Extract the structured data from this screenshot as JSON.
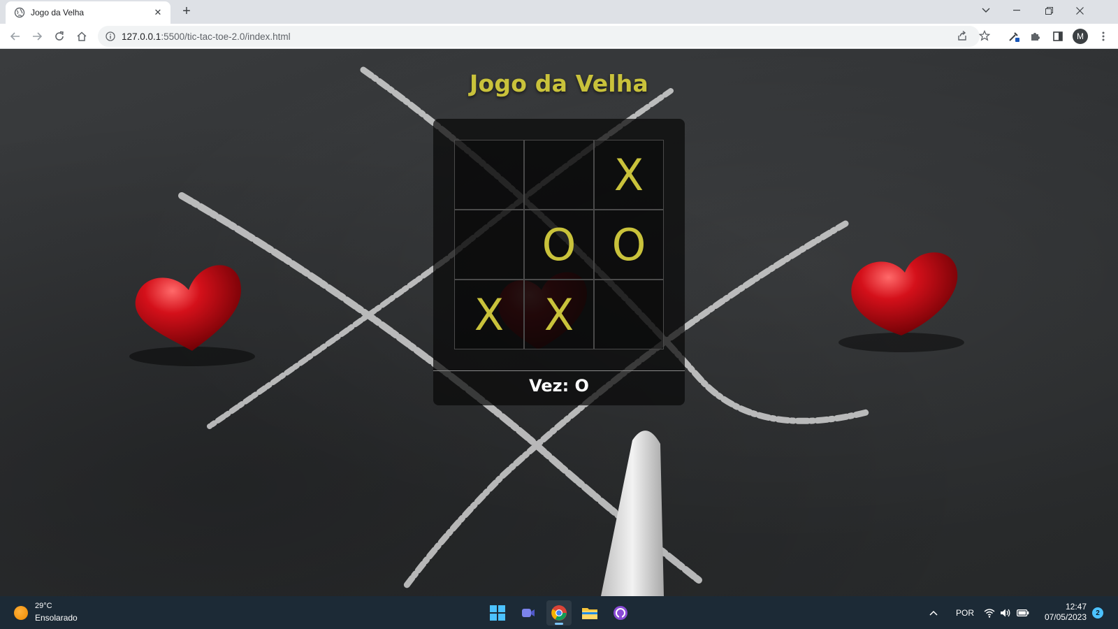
{
  "browser": {
    "tab_title": "Jogo da Velha",
    "url_host": "127.0.0.1",
    "url_path": ":5500/tic-tac-toe-2.0/index.html",
    "profile_initial": "M"
  },
  "page": {
    "title": "Jogo da Velha",
    "board": [
      [
        "",
        "",
        "X"
      ],
      [
        "",
        "O",
        "O"
      ],
      [
        "X",
        "X",
        ""
      ]
    ],
    "status": "Vez: O",
    "accent_color": "#c9c23b"
  },
  "taskbar": {
    "weather_temp": "29°C",
    "weather_desc": "Ensolarado",
    "language": "POR",
    "time": "12:47",
    "date": "07/05/2023",
    "notification_count": "2",
    "apps": [
      "windows-start-icon",
      "teams-icon",
      "chrome-icon",
      "file-explorer-icon",
      "github-desktop-icon"
    ]
  }
}
